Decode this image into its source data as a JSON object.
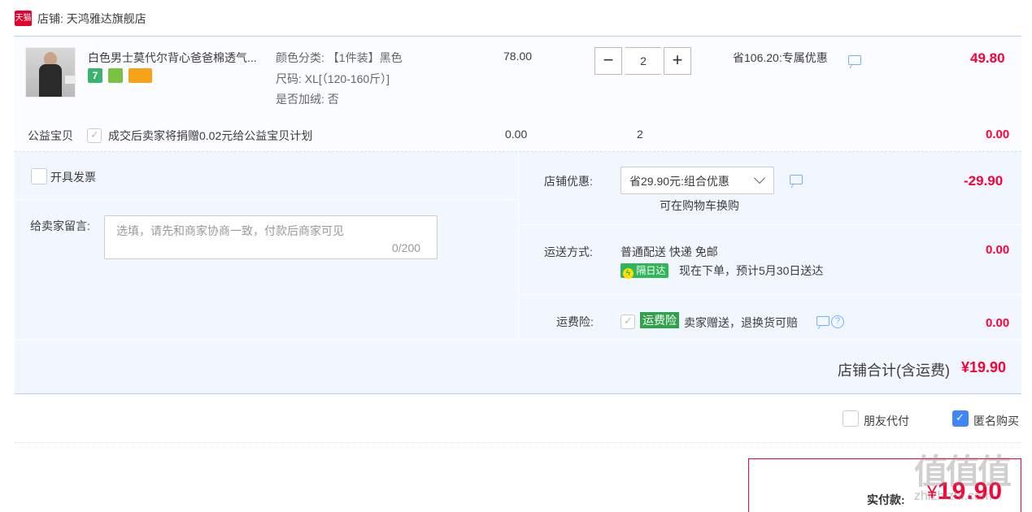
{
  "shop": {
    "logo_text": "天猫",
    "label": "店铺: 天鸿雅达旗舰店"
  },
  "item": {
    "title": "白色男士莫代尔背心爸爸棉透气...",
    "badges": [
      "7",
      "",
      ""
    ],
    "sku_color": "颜色分类: 【1件装】黑色",
    "sku_size": "尺码: XL[（120-160斤）]",
    "sku_fleece": "是否加绒: 否",
    "unit_price": "78.00",
    "quantity": "2",
    "minus": "−",
    "plus": "+",
    "saving": "省106.20:专属优惠",
    "subtotal": "49.80"
  },
  "charity": {
    "label": "公益宝贝",
    "text": "成交后卖家将捐赠0.02元给公益宝贝计划",
    "price": "0.00",
    "quantity": "2",
    "subtotal": "0.00"
  },
  "options": {
    "invoice_label": "开具发票",
    "message_label": "给卖家留言:",
    "message_placeholder": "选填，请先和商家协商一致，付款后商家可见",
    "message_count": "0/200",
    "shop_discount_label": "店铺优惠:",
    "shop_discount_value": "省29.90元:组合优惠",
    "shop_discount_note": "可在购物车换购",
    "shop_discount_amount": "-29.90",
    "shipping_label": "运送方式:",
    "shipping_value": "普通配送 快递 免邮",
    "shipping_tag": "隔日达",
    "shipping_eta": "现在下单，预计5月30日送达",
    "shipping_amount": "0.00",
    "insurance_label": "运费险:",
    "insurance_tag": "运费险",
    "insurance_text": "卖家赠送，退换货可赔",
    "insurance_amount": "0.00"
  },
  "summary": {
    "total_label": "店铺合计(含运费)",
    "total_amount": "¥19.90"
  },
  "payment": {
    "friend_pay": "朋友代付",
    "anonymous": "匿名购买",
    "actual_label": "实付款:",
    "currency": "¥",
    "actual_amount": "19.90"
  },
  "watermark": {
    "main": "值值值",
    "sub": "zhizhizhi.com"
  },
  "colors": {
    "price_red": "#ff0036",
    "accent_blue": "#3f86f7",
    "panel_bg": "#f2f7ff",
    "ship_green": "#31b45a"
  }
}
